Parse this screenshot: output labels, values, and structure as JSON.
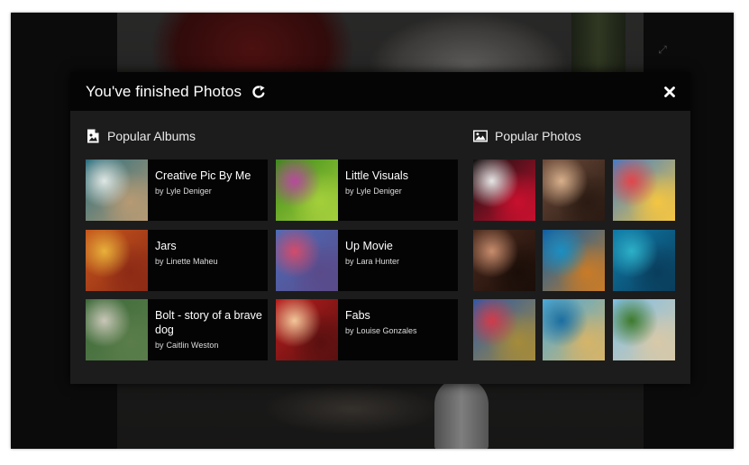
{
  "modal": {
    "title": "You've finished Photos"
  },
  "albums_section": {
    "title": "Popular Albums",
    "by_prefix": "by",
    "items": [
      {
        "name": "Creative Pic By Me",
        "author": "Lyle Deniger",
        "thumb_colors": [
          "#2b6f7f",
          "#dfe7e4",
          "#b79a73"
        ]
      },
      {
        "name": "Little Visuals",
        "author": "Lyle Deniger",
        "thumb_colors": [
          "#3c8a1a",
          "#b64a9c",
          "#a4cf3b"
        ]
      },
      {
        "name": "Jars",
        "author": "Linette Maheu",
        "thumb_colors": [
          "#c6561c",
          "#e8b13a",
          "#8c2a16"
        ]
      },
      {
        "name": "Up Movie",
        "author": "Lara Hunter",
        "thumb_colors": [
          "#4b6cb7",
          "#d34b6b",
          "#5a4a8a"
        ]
      },
      {
        "name": "Bolt - story of a brave dog",
        "author": "Caitlin Weston",
        "thumb_colors": [
          "#3d6a3a",
          "#c9c7b8",
          "#5a7d4a"
        ]
      },
      {
        "name": "Fabs",
        "author": "Louise Gonzales",
        "thumb_colors": [
          "#b81d1d",
          "#f2c79a",
          "#5a1010"
        ]
      }
    ]
  },
  "photos_section": {
    "title": "Popular Photos",
    "items": [
      {
        "alt": "team-crest-photo",
        "colors": [
          "#111111",
          "#e6e6e6",
          "#c8102e"
        ]
      },
      {
        "alt": "portrait-woman-photo",
        "colors": [
          "#6b4a3a",
          "#d8b08c",
          "#2a1a12"
        ]
      },
      {
        "alt": "balloon-house-photo",
        "colors": [
          "#3f7fc8",
          "#e2464a",
          "#f4c542"
        ]
      },
      {
        "alt": "portrait-actress-photo",
        "colors": [
          "#4a2a1e",
          "#c88d6d",
          "#1a0d08"
        ]
      },
      {
        "alt": "scuba-diver-photo",
        "colors": [
          "#0d5fa5",
          "#1b8fc2",
          "#c97b27"
        ]
      },
      {
        "alt": "underwater-divers-photo",
        "colors": [
          "#0f7aa8",
          "#2db0c8",
          "#0a3d5c"
        ]
      },
      {
        "alt": "balloon-house-close-photo",
        "colors": [
          "#2b5aa8",
          "#d23b4a",
          "#a58b3a"
        ]
      },
      {
        "alt": "snorkel-reef-photo",
        "colors": [
          "#4aa8d8",
          "#1b6ea0",
          "#d6b468"
        ]
      },
      {
        "alt": "animated-boy-photo",
        "colors": [
          "#7fbfe8",
          "#3e7a2c",
          "#d8c9a8"
        ]
      }
    ]
  }
}
